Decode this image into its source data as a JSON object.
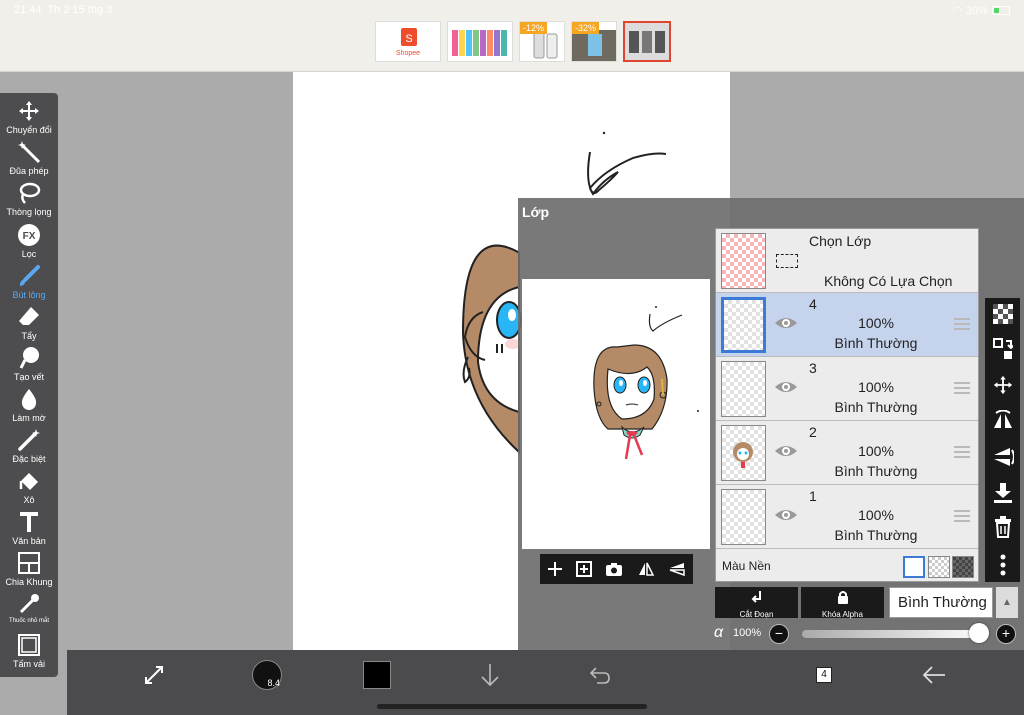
{
  "status": {
    "time": "21:44",
    "date": "Th 2 15 thg 3",
    "battery": "30%"
  },
  "ads": [
    {
      "name": "Shopee",
      "discount": ""
    },
    {
      "name": "",
      "discount": ""
    },
    {
      "name": "",
      "discount": "-12%"
    },
    {
      "name": "",
      "discount": "-32%"
    },
    {
      "name": "",
      "discount": ""
    }
  ],
  "toolbar": {
    "tools": [
      {
        "label": "Chuyển đổi",
        "icon": "move-icon"
      },
      {
        "label": "Đũa phép",
        "icon": "magic-wand-icon"
      },
      {
        "label": "Thòng lọng",
        "icon": "lasso-icon"
      },
      {
        "label": "Lọc",
        "icon": "fx-filter-icon"
      },
      {
        "label": "Bút lông",
        "icon": "brush-icon",
        "active": true
      },
      {
        "label": "Tẩy",
        "icon": "eraser-icon"
      },
      {
        "label": "Tạo vết",
        "icon": "smudge-icon"
      },
      {
        "label": "Làm mờ",
        "icon": "blur-drop-icon"
      },
      {
        "label": "Đặc biệt",
        "icon": "special-brush-icon"
      },
      {
        "label": "Xô",
        "icon": "bucket-icon"
      },
      {
        "label": "Văn bản",
        "icon": "text-icon"
      },
      {
        "label": "Chia Khung",
        "icon": "frame-divider-icon"
      },
      {
        "label": "Thuốc nhỏ mắt",
        "icon": "eyedropper-icon"
      },
      {
        "label": "Tấm vải",
        "icon": "canvas-icon"
      }
    ]
  },
  "layer_panel": {
    "title": "Lớp",
    "selection": {
      "title": "Chọn Lớp",
      "status": "Không Có Lựa Chọn"
    },
    "layers": [
      {
        "number": "4",
        "opacity": "100%",
        "blend": "Bình Thường",
        "selected": true
      },
      {
        "number": "3",
        "opacity": "100%",
        "blend": "Bình Thường"
      },
      {
        "number": "2",
        "opacity": "100%",
        "blend": "Bình Thường"
      },
      {
        "number": "1",
        "opacity": "100%",
        "blend": "Bình Thường"
      }
    ],
    "background_label": "Màu Nền",
    "clip_label": "Cắt Đoạn",
    "alpha_lock_label": "Khóa Alpha",
    "blend_mode": "Bình Thường",
    "alpha_symbol": "α",
    "alpha_value": "100%"
  },
  "bottombar": {
    "brush_size": "8.4",
    "layer_count": "4",
    "color": "#000000"
  },
  "colors": {
    "accent": "#3b7bd6",
    "active_tool": "#5aa9f0",
    "toolbar_bg": "#4d4d4f"
  }
}
